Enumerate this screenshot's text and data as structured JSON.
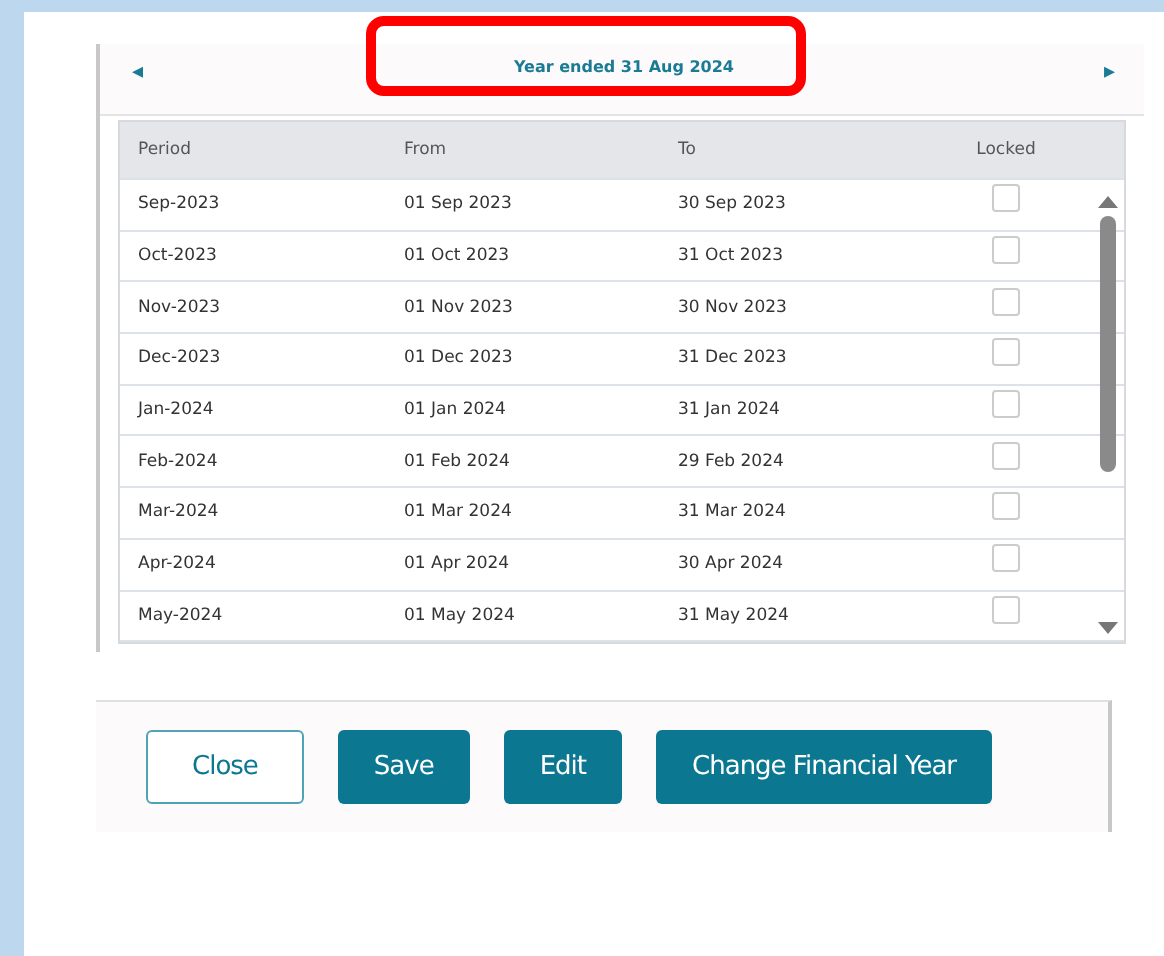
{
  "year_nav": {
    "title": "Year ended 31 Aug 2024",
    "highlighted": true,
    "prev": "◂",
    "next": "▸"
  },
  "table": {
    "columns": [
      "Period",
      "From",
      "To",
      "Locked"
    ],
    "rows": [
      {
        "period": "Sep-2023",
        "from": "01 Sep 2023",
        "to": "30 Sep 2023",
        "locked": false
      },
      {
        "period": "Oct-2023",
        "from": "01 Oct 2023",
        "to": "31 Oct 2023",
        "locked": false
      },
      {
        "period": "Nov-2023",
        "from": "01 Nov 2023",
        "to": "30 Nov 2023",
        "locked": false
      },
      {
        "period": "Dec-2023",
        "from": "01 Dec 2023",
        "to": "31 Dec 2023",
        "locked": false
      },
      {
        "period": "Jan-2024",
        "from": "01 Jan 2024",
        "to": "31 Jan 2024",
        "locked": false
      },
      {
        "period": "Feb-2024",
        "from": "01 Feb 2024",
        "to": "29 Feb 2024",
        "locked": false
      },
      {
        "period": "Mar-2024",
        "from": "01 Mar 2024",
        "to": "31 Mar 2024",
        "locked": false
      },
      {
        "period": "Apr-2024",
        "from": "01 Apr 2024",
        "to": "30 Apr 2024",
        "locked": false
      },
      {
        "period": "May-2024",
        "from": "01 May 2024",
        "to": "31 May 2024",
        "locked": false
      }
    ]
  },
  "buttons": [
    {
      "label": "Close",
      "kind": "secondary"
    },
    {
      "label": "Save",
      "kind": "primary"
    },
    {
      "label": "Edit",
      "kind": "primary"
    },
    {
      "label": "Change Financial Year",
      "kind": "primary"
    }
  ]
}
